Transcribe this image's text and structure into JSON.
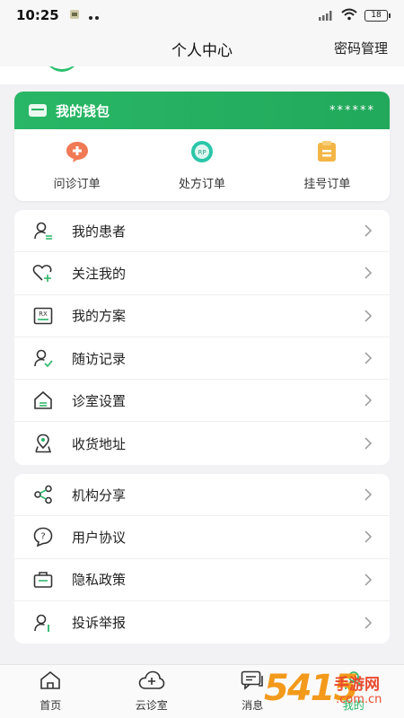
{
  "status_bar": {
    "time": "10:25",
    "battery": "18"
  },
  "nav": {
    "title": "个人中心",
    "action": "密码管理"
  },
  "wallet": {
    "title": "我的钱包",
    "balance_mask": "******",
    "orders": [
      {
        "label": "问诊订单",
        "icon": "consult-order-icon",
        "color": "#f07a55"
      },
      {
        "label": "处方订单",
        "icon": "prescription-order-icon",
        "color": "#2cc6a9"
      },
      {
        "label": "挂号订单",
        "icon": "registration-order-icon",
        "color": "#f3b646"
      }
    ]
  },
  "menu_group_1": [
    {
      "label": "我的患者",
      "icon": "patient-icon"
    },
    {
      "label": "关注我的",
      "icon": "heart-plus-icon"
    },
    {
      "label": "我的方案",
      "icon": "rx-plan-icon"
    },
    {
      "label": "随访记录",
      "icon": "followup-icon"
    },
    {
      "label": "诊室设置",
      "icon": "clinic-settings-icon"
    },
    {
      "label": "收货地址",
      "icon": "address-icon"
    }
  ],
  "menu_group_2": [
    {
      "label": "机构分享",
      "icon": "share-icon"
    },
    {
      "label": "用户协议",
      "icon": "agreement-icon"
    },
    {
      "label": "隐私政策",
      "icon": "privacy-icon"
    },
    {
      "label": "投诉举报",
      "icon": "report-icon"
    }
  ],
  "tabs": [
    {
      "label": "首页",
      "icon": "home-icon"
    },
    {
      "label": "云诊室",
      "icon": "cloud-clinic-icon"
    },
    {
      "label": "消息",
      "icon": "message-icon"
    },
    {
      "label": "我的",
      "icon": "profile-icon"
    }
  ],
  "watermark": {
    "number": "5415",
    "name": "手游网",
    "domain": ".com.cn"
  },
  "colors": {
    "accent": "#27b565",
    "background": "#f2f2f4"
  }
}
